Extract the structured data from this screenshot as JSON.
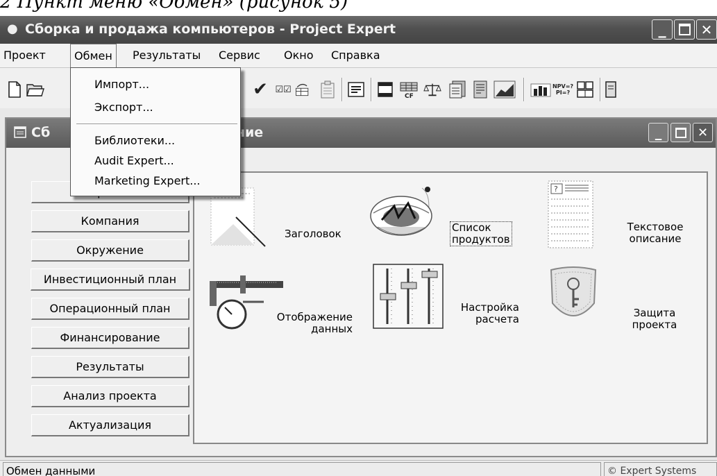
{
  "caption": "2 Пункт меню «Обмен» (рисунок 5)",
  "window": {
    "title": "Сборка и продажа компьютеров - Project Expert",
    "icon": "lightbulb-icon"
  },
  "menu": [
    "Проект",
    "Обмен",
    "Результаты",
    "Сервис",
    "Окно",
    "Справка"
  ],
  "dropdown": {
    "items": [
      "Импорт...",
      "Экспорт...",
      "Библиотеки...",
      "Audit Expert...",
      "Marketing Expert..."
    ]
  },
  "toolbar_icons": [
    "new-document-icon",
    "open-folder-icon",
    "checkmark-icon",
    "checkbox-pair-icon",
    "refresh-table-icon",
    "clipboard-icon",
    "list-view-icon",
    "window-icon",
    "cashflow-chart-icon",
    "scales-icon",
    "report-icon",
    "document-icon",
    "line-chart-icon",
    "bar-chart-icon",
    "npv-pi-icon",
    "table-grid-icon",
    "print-icon"
  ],
  "child_window": {
    "title": "Сборка и продажа компьютеров - Содержание",
    "title_visible": "Сб        ьютеров - Содержание"
  },
  "nav": [
    "Проект",
    "Компания",
    "Окружение",
    "Инвестиционный план",
    "Операционный план",
    "Финансирование",
    "Результаты",
    "Анализ проекта",
    "Актуализация"
  ],
  "items": [
    {
      "label": [
        "Заголовок"
      ],
      "icon": "title-page-icon"
    },
    {
      "label": [
        "Список",
        "продуктов"
      ],
      "icon": "product-basket-icon"
    },
    {
      "label": [
        "Текстовое",
        "описание"
      ],
      "icon": "text-document-icon"
    },
    {
      "label": [
        "Отображение",
        "данных"
      ],
      "icon": "caliper-gauge-icon"
    },
    {
      "label": [
        "Настройка",
        "расчета"
      ],
      "icon": "sliders-icon"
    },
    {
      "label": [
        "Защита",
        "проекта"
      ],
      "icon": "shield-key-icon"
    }
  ],
  "status": {
    "left": "Обмен данными",
    "right": "© Expert Systems"
  }
}
